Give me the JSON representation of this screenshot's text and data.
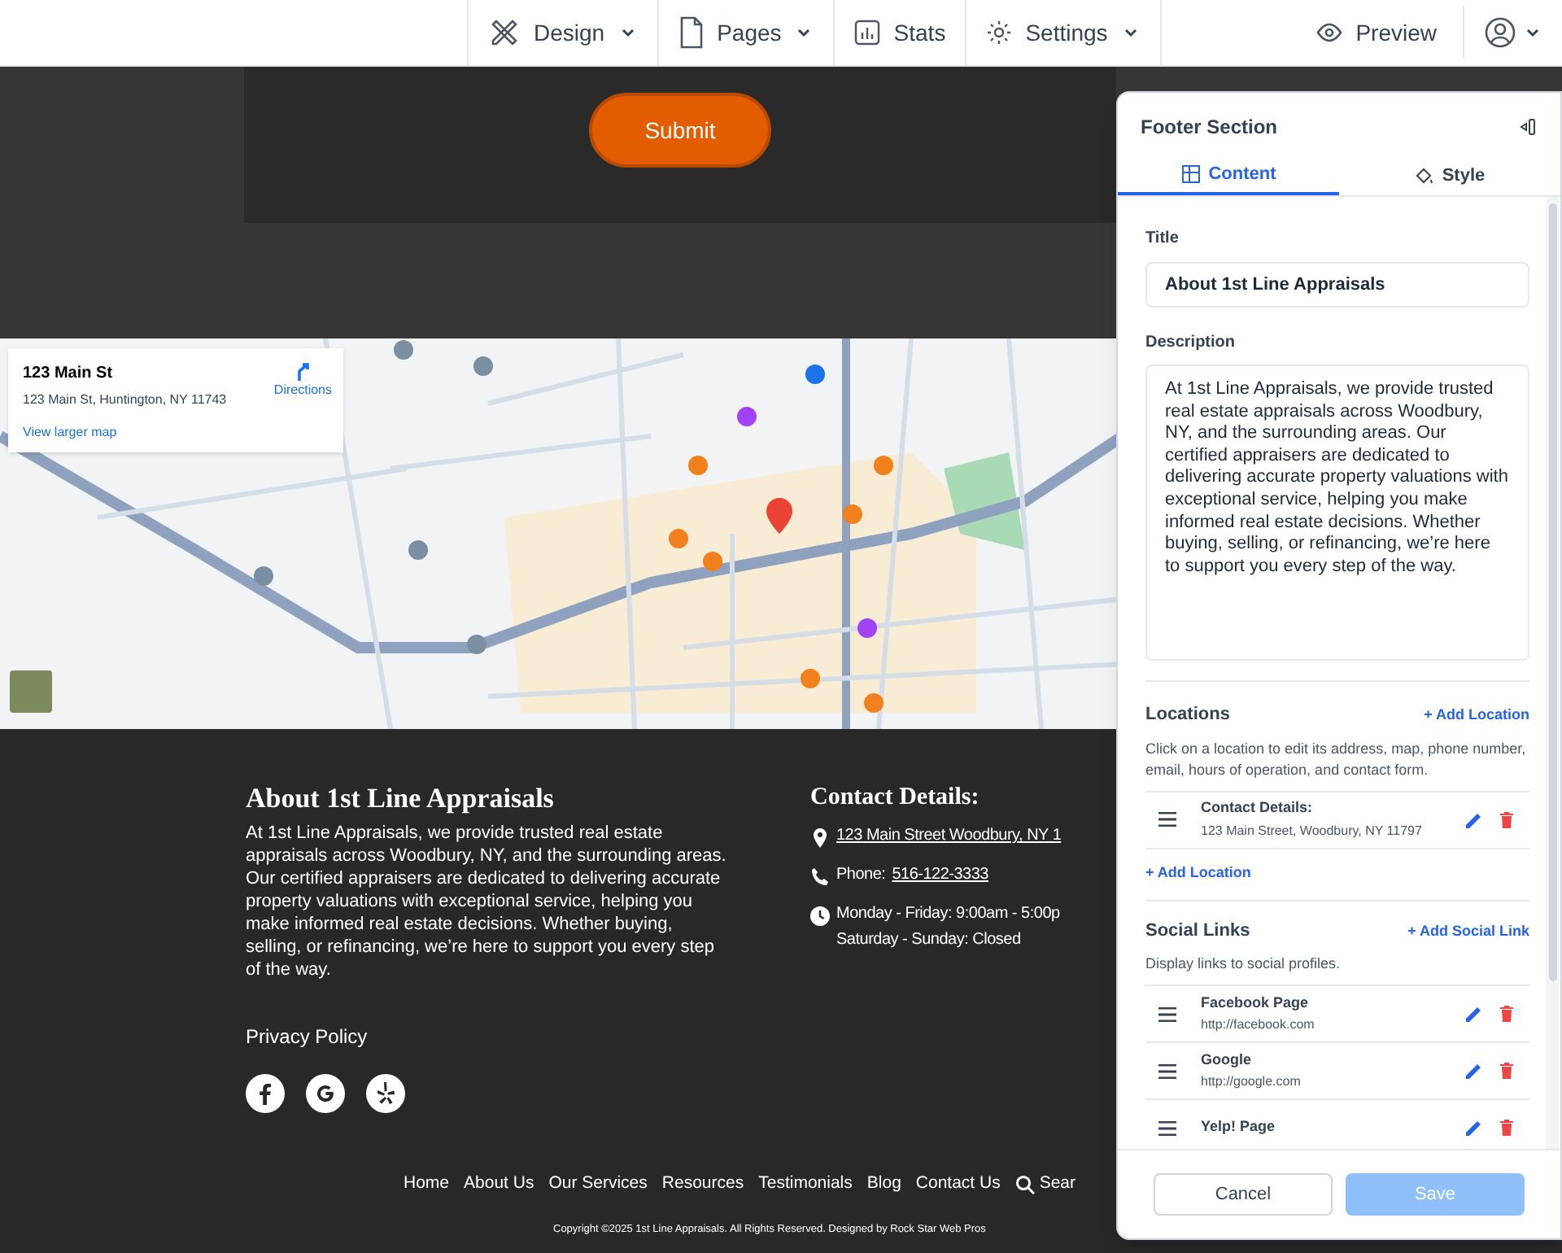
{
  "top_nav": {
    "menus": [
      {
        "label": "Design",
        "dropdown": true
      },
      {
        "label": "Pages",
        "dropdown": true
      },
      {
        "label": "Stats",
        "dropdown": false
      },
      {
        "label": "Settings",
        "dropdown": true
      }
    ],
    "preview": "Preview"
  },
  "form": {
    "submit": "Submit"
  },
  "map": {
    "place_name": "123 Main St",
    "address": "123 Main St, Huntington, NY 11743",
    "directions": "Directions",
    "view_larger": "View larger map"
  },
  "footer": {
    "title": "About 1st Line Appraisals",
    "description": "At 1st Line Appraisals, we provide trusted real estate appraisals across Woodbury, NY, and the surrounding areas. Our certified appraisers are dedicated to delivering accurate property valuations with exceptional service, helping you make informed real estate decisions. Whether buying, selling, or refinancing, we’re here to support you every step of the way.",
    "privacy": "Privacy Policy",
    "social": [
      {
        "kind": "facebook"
      },
      {
        "kind": "google"
      },
      {
        "kind": "yelp"
      }
    ],
    "contact_title": "Contact Details:",
    "contact_items": [
      {
        "kind": "address",
        "link": "123 Main Street Woodbury, NY 1"
      },
      {
        "kind": "phone",
        "label": "Phone:",
        "link": "516-122-3333"
      },
      {
        "kind": "hours",
        "lines": [
          "Monday - Friday: 9:00am - 5:00p",
          "Saturday - Sunday: Closed"
        ]
      }
    ],
    "nav_links": [
      "Home",
      "About Us",
      "Our Services",
      "Resources",
      "Testimonials",
      "Blog",
      "Contact Us"
    ],
    "search": "Sear",
    "copyright": "Copyright ©2025 1st Line Appraisals. All Rights Reserved. Designed by Rock Star Web Pros"
  },
  "panel": {
    "title": "Footer Section",
    "tabs": [
      {
        "label": "Content",
        "selected": true
      },
      {
        "label": "Style",
        "selected": false
      }
    ],
    "title_label": "Title",
    "title_value": "About 1st Line Appraisals",
    "description_label": "Description",
    "description_value": "At 1st Line Appraisals, we provide trusted real estate appraisals across Woodbury, NY, and the surrounding areas. Our certified appraisers are dedicated to delivering accurate property valuations with exceptional service, helping you make informed real estate decisions. Whether buying, selling, or refinancing, we’re here to support you every step of the way.",
    "locations": {
      "heading": "Locations",
      "add": "+ Add Location",
      "hint": "Click on a location to edit its address, map, phone number, email, hours of operation, and contact form.",
      "items": [
        {
          "name": "Contact Details:",
          "detail": "123 Main Street, Woodbury, NY 11797"
        }
      ],
      "add_bottom": "+ Add Location"
    },
    "social": {
      "heading": "Social Links",
      "add": "+ Add Social Link",
      "hint": "Display links to social profiles.",
      "items": [
        {
          "name": "Facebook Page",
          "detail": "http://facebook.com"
        },
        {
          "name": "Google",
          "detail": "http://google.com"
        },
        {
          "name": "Yelp! Page"
        }
      ]
    },
    "cancel": "Cancel",
    "save": "Save",
    "save_disabled": true
  }
}
